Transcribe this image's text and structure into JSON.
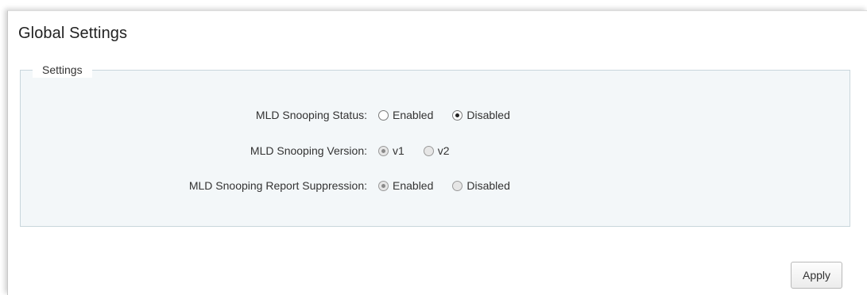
{
  "page": {
    "title": "Global Settings"
  },
  "settings": {
    "legend": "Settings",
    "rows": [
      {
        "label": "MLD Snooping Status:",
        "options": [
          {
            "label": "Enabled",
            "checked": false,
            "disabled": false
          },
          {
            "label": "Disabled",
            "checked": true,
            "disabled": false
          }
        ]
      },
      {
        "label": "MLD Snooping Version:",
        "options": [
          {
            "label": "v1",
            "checked": true,
            "disabled": true
          },
          {
            "label": "v2",
            "checked": false,
            "disabled": true
          }
        ]
      },
      {
        "label": "MLD Snooping Report Suppression:",
        "options": [
          {
            "label": "Enabled",
            "checked": true,
            "disabled": true
          },
          {
            "label": "Disabled",
            "checked": false,
            "disabled": true
          }
        ]
      }
    ]
  },
  "actions": {
    "apply_label": "Apply"
  }
}
